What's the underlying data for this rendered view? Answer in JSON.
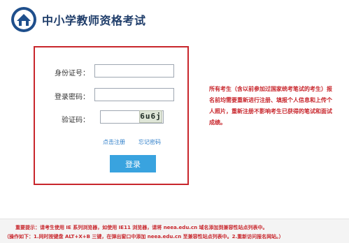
{
  "header": {
    "title": "中小学教师资格考试"
  },
  "login": {
    "id_label": "身份证号：",
    "id_value": "",
    "password_label": "登录密码：",
    "password_value": "",
    "captcha_label": "验证码：",
    "captcha_value": "",
    "captcha_text": "6u6j",
    "register_link": "点击注册",
    "forgot_link": "忘记密码",
    "login_button": "登录"
  },
  "notice": {
    "text": "所有考生（含以前参加过国家统考笔试的考生）报名前均需要重新进行注册、填报个人信息和上传个人照片，重新注册不影响考生已获得的笔试和面试成绩。"
  },
  "footer": {
    "line1": "重要提示：请考生使用 IE 系列浏览器，如使用 IE11 浏览器，请将 neea.edu.cn 域名添加到兼容性站点列表中。",
    "line2": "（操作如下：1.同时按键盘 ALT+X+B 三键，在弹出窗口中添加 neea.edu.cn 至兼容性站点列表中。2.重新访问报名网站。）"
  },
  "colors": {
    "accent_red": "#c8262c",
    "button_blue": "#39a3df",
    "link_blue": "#2e7ec9",
    "title_navy": "#1f3d6a"
  }
}
